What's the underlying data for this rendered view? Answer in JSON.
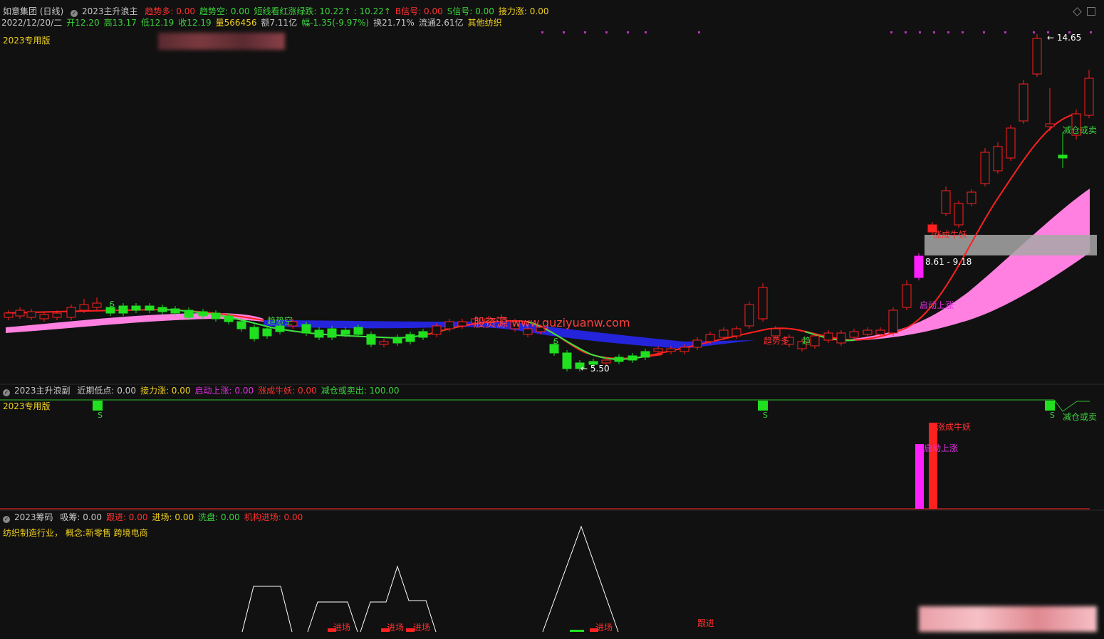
{
  "main": {
    "title": "如意集团 (日线)",
    "indicator": "2023主升浪主",
    "params": [
      {
        "label": "趋势多: 0.00",
        "color": "#ff3030"
      },
      {
        "label": "趋势空: 0.00",
        "color": "#3cd23c"
      },
      {
        "label": "短线看红涨绿跌: 10.22↑ : 10.22↑",
        "color": "#3cd23c"
      },
      {
        "label": "B信号: 0.00",
        "color": "#ff3030"
      },
      {
        "label": "S信号: 0.00",
        "color": "#3cd23c"
      },
      {
        "label": "接力涨: 0.00",
        "color": "#f0d020"
      }
    ],
    "info": [
      {
        "label": "2022/12/20/二",
        "color": "#c8c8c8"
      },
      {
        "label": "开12.20",
        "color": "#3cd23c"
      },
      {
        "label": "高13.17",
        "color": "#3cd23c"
      },
      {
        "label": "低12.19",
        "color": "#3cd23c"
      },
      {
        "label": "收12.19",
        "color": "#3cd23c"
      },
      {
        "label": "量566456",
        "color": "#f0d020"
      },
      {
        "label": "额7.11亿",
        "color": "#c8c8c8"
      },
      {
        "label": "幅-1.35(-9.97%)",
        "color": "#3cd23c"
      },
      {
        "label": "换21.71%",
        "color": "#c8c8c8"
      },
      {
        "label": "流通2.61亿",
        "color": "#c8c8c8"
      },
      {
        "label": "其他纺织",
        "color": "#f0d020"
      }
    ],
    "version_tag": "2023专用版",
    "watermark": "股资源 www.guziyuanw.com",
    "labels": {
      "high": "14.65",
      "low": "5.50",
      "zone": "8.61 - 9.18",
      "trend_short": "趋势空",
      "trend_short2": "趋势多",
      "trend_mix": "趋",
      "start_rise": "启动上涨",
      "monster": "涨成牛妖",
      "reduce": "减仓或卖",
      "s_mark": "S"
    }
  },
  "sub1": {
    "indicator": "2023主升浪副",
    "params": [
      {
        "label": "近期低点: 0.00",
        "color": "#c8c8c8"
      },
      {
        "label": "接力涨: 0.00",
        "color": "#f0d020"
      },
      {
        "label": "启动上涨: 0.00",
        "color": "#e030e0"
      },
      {
        "label": "涨成牛妖: 0.00",
        "color": "#ff3030"
      },
      {
        "label": "减仓或卖出: 100.00",
        "color": "#3cd23c"
      }
    ],
    "version_tag": "2023专用版",
    "labels": {
      "s_mark": "S",
      "monster": "涨成牛妖",
      "start_rise": "启动上涨",
      "reduce": "减仓或卖"
    }
  },
  "sub2": {
    "indicator": "2023筹码",
    "params": [
      {
        "label": "吸筹: 0.00",
        "color": "#c8c8c8"
      },
      {
        "label": "跟进: 0.00",
        "color": "#ff3030"
      },
      {
        "label": "进场: 0.00",
        "color": "#f0d020"
      },
      {
        "label": "洗盘: 0.00",
        "color": "#3cd23c"
      },
      {
        "label": "机构进场: 0.00",
        "color": "#ff3030"
      }
    ],
    "industry": "纺织制造行业，  概念:新零售  跨境电商",
    "labels": {
      "enter": "进场",
      "follow": "跟进"
    }
  },
  "colors": {
    "up": "#ff2020",
    "down": "#20e020",
    "bg": "#111111",
    "pink": "#ff80e0",
    "blue": "#2828ff"
  }
}
